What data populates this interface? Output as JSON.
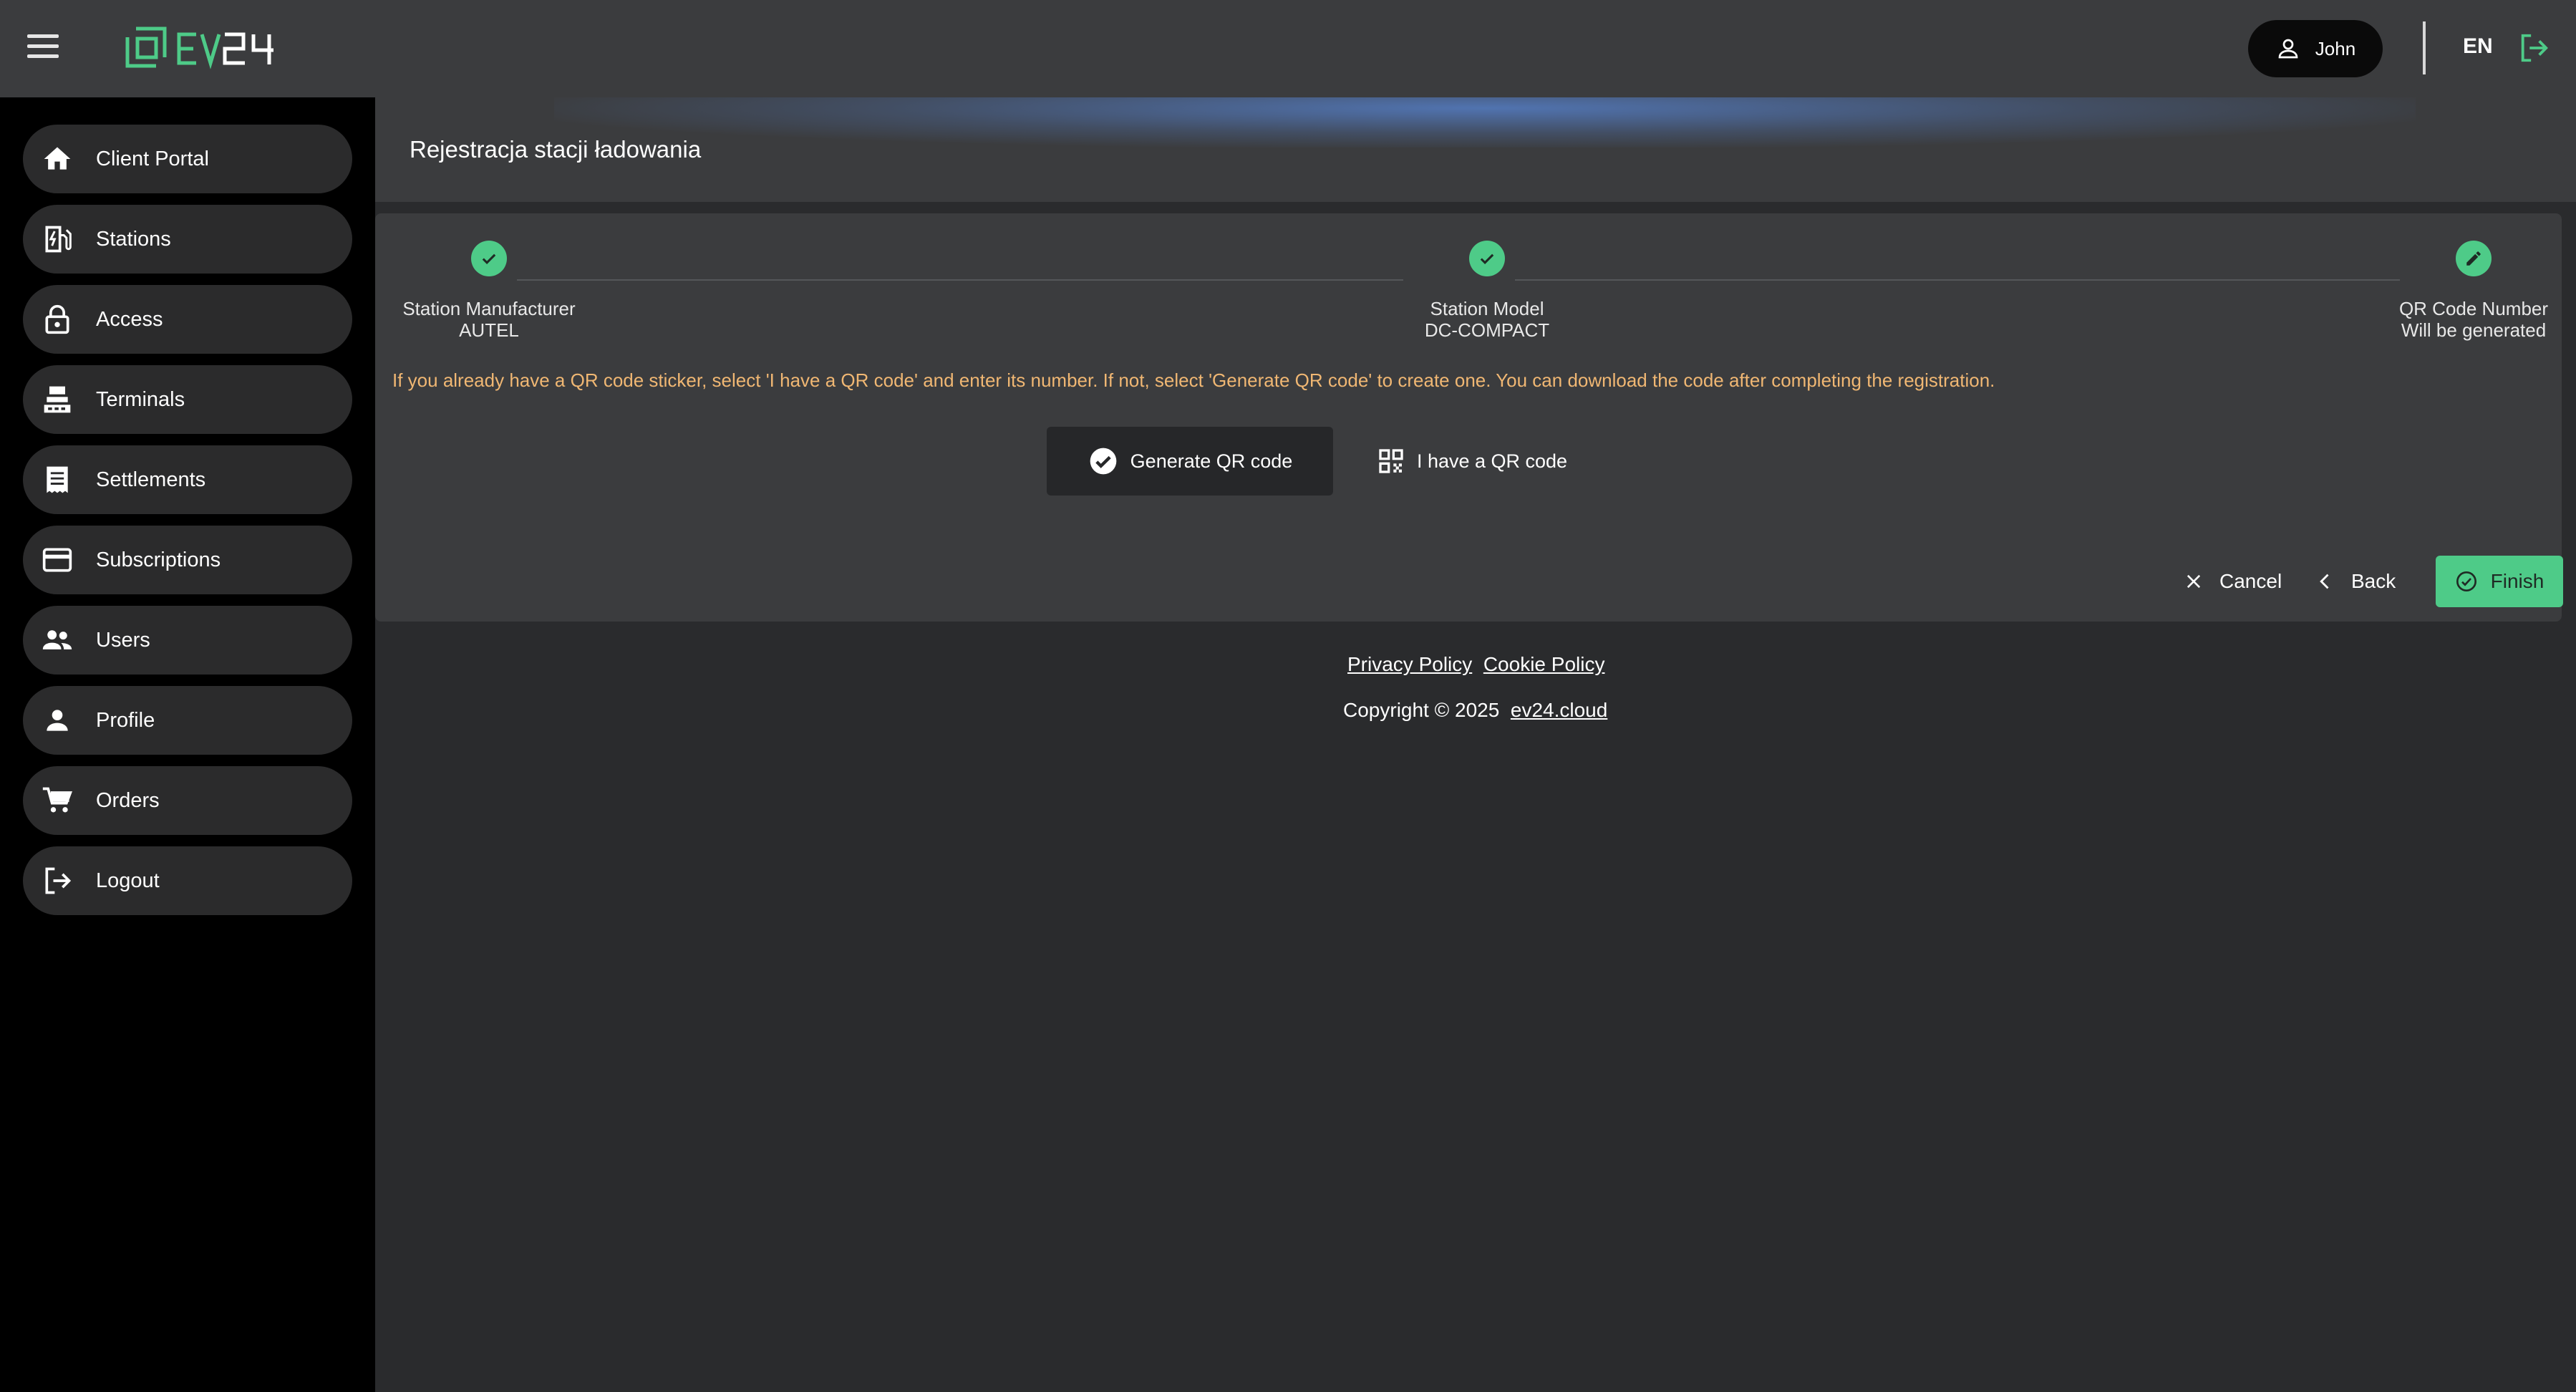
{
  "header": {
    "brand": "EV24",
    "user_name": "John",
    "language": "EN"
  },
  "sidebar": {
    "items": [
      {
        "label": "Client Portal",
        "icon": "home-icon"
      },
      {
        "label": "Stations",
        "icon": "ev-station-icon"
      },
      {
        "label": "Access",
        "icon": "lock-icon"
      },
      {
        "label": "Terminals",
        "icon": "terminal-icon"
      },
      {
        "label": "Settlements",
        "icon": "receipt-icon"
      },
      {
        "label": "Subscriptions",
        "icon": "credit-card-icon"
      },
      {
        "label": "Users",
        "icon": "group-icon"
      },
      {
        "label": "Profile",
        "icon": "person-icon"
      },
      {
        "label": "Orders",
        "icon": "cart-icon"
      },
      {
        "label": "Logout",
        "icon": "logout-icon"
      }
    ]
  },
  "page": {
    "title": "Rejestracja stacji ładowania"
  },
  "stepper": {
    "steps": [
      {
        "title": "Station Manufacturer",
        "value": "AUTEL",
        "state": "done"
      },
      {
        "title": "Station Model",
        "value": "DC-COMPACT",
        "state": "done"
      },
      {
        "title": "QR Code Number",
        "value": "Will be generated",
        "state": "edit"
      }
    ],
    "hint": "If you already have a QR code sticker, select 'I have a QR code' and enter its number. If not, select 'Generate QR code' to create one. You can download the code after completing the registration.",
    "options": {
      "generate_label": "Generate QR code",
      "have_label": "I have a QR code",
      "selected": "generate"
    },
    "actions": {
      "cancel_label": "Cancel",
      "back_label": "Back",
      "finish_label": "Finish"
    }
  },
  "footer": {
    "privacy_label": "Privacy Policy",
    "cookie_label": "Cookie Policy",
    "copyright": "Copyright © 2025",
    "site_link": "ev24.cloud"
  },
  "colors": {
    "accent": "#4ecb88",
    "hint": "#f0b773",
    "topbar": "#3b3c3e",
    "sidebar": "#000000",
    "background": "#2a2b2d"
  }
}
